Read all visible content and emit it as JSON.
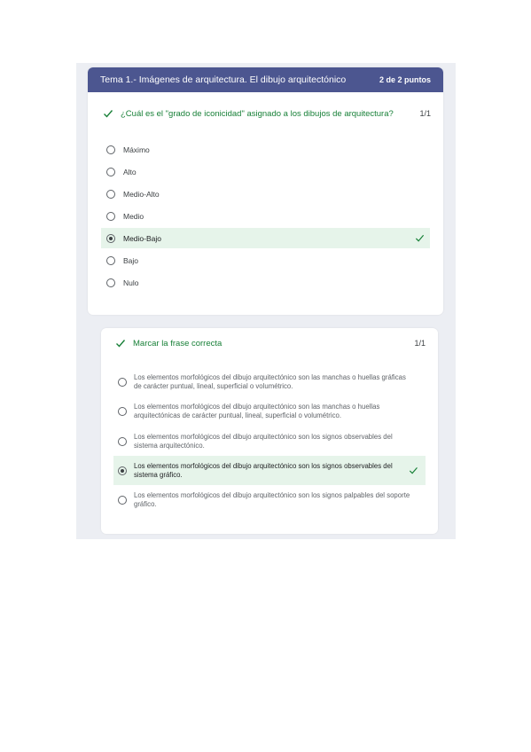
{
  "header": {
    "title": "Tema 1.- Imágenes de arquitectura. El dibujo arquitectónico",
    "points": "2 de 2 puntos"
  },
  "question1": {
    "text": "¿Cuál es el \"grado de iconicidad\" asignado a los dibujos de arquitectura?",
    "score": "1/1",
    "options": [
      "Máximo",
      "Alto",
      "Medio-Alto",
      "Medio",
      "Medio-Bajo",
      "Bajo",
      "Nulo"
    ],
    "selected": "Medio-Bajo"
  },
  "question2": {
    "text": "Marcar la frase correcta",
    "score": "1/1",
    "options": [
      "Los elementos morfológicos del dibujo arquitectónico son las manchas o huellas gráficas de carácter puntual, lineal, superficial o volumétrico.",
      "Los elementos morfológicos del dibujo arquitectónico son las manchas o huellas arquitectónicas de carácter puntual, lineal, superficial o volumétrico.",
      "Los elementos morfológicos del dibujo arquitectónico son los signos observables del sistema arquitectónico.",
      "Los elementos morfológicos del dibujo arquitectónico son los signos observables del sistema gráfico.",
      "Los elementos morfológicos del dibujo arquitectónico son los signos palpables del soporte gráfico."
    ],
    "selected_index": 3
  },
  "colors": {
    "header": "#4c5690",
    "correct": "#188038",
    "selected_bg": "#e6f4ea"
  }
}
